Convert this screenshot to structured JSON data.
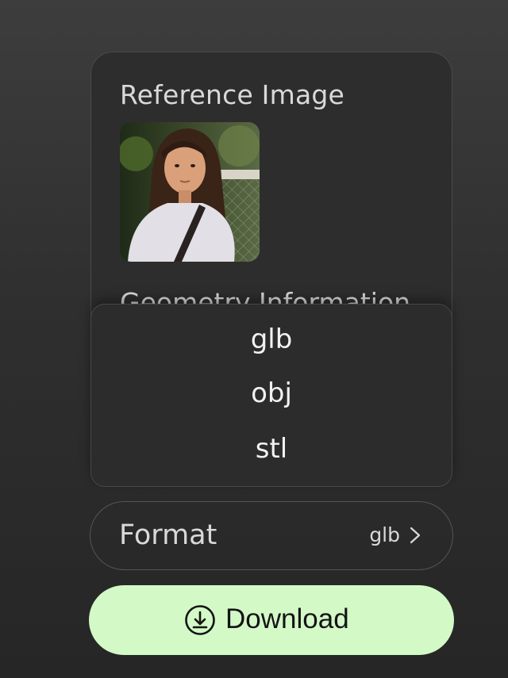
{
  "panel": {
    "reference_title": "Reference Image",
    "geometry_title": "Geometry Information"
  },
  "format_dropdown": {
    "options": [
      "glb",
      "obj",
      "stl"
    ]
  },
  "format": {
    "label": "Format",
    "value": "glb"
  },
  "download": {
    "label": "Download"
  },
  "icons": {
    "chevron": "chevron-right-icon",
    "download": "download-icon"
  },
  "colors": {
    "accent": "#d3f9c7",
    "panel": "#2d2d2d",
    "text": "#d9d9d9"
  }
}
